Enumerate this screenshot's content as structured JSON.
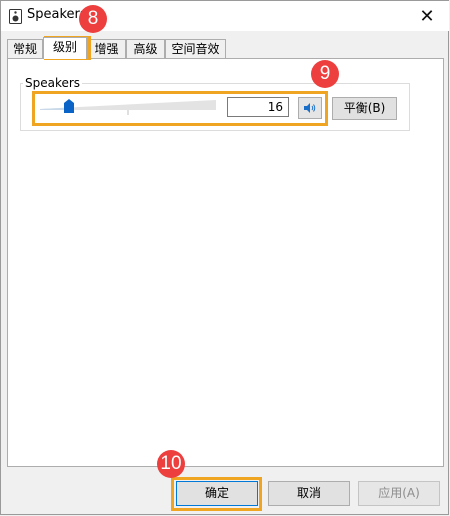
{
  "window": {
    "title": "Speakers",
    "close_icon": "close-icon",
    "app_icon": "speaker-device-icon"
  },
  "tabs": [
    {
      "label": "常规",
      "active": false
    },
    {
      "label": "级别",
      "active": true
    },
    {
      "label": "增强",
      "active": false
    },
    {
      "label": "高级",
      "active": false
    },
    {
      "label": "空间音效",
      "active": false
    }
  ],
  "levels": {
    "device_label": "Speakers",
    "volume_value": "16",
    "volume_fraction": 0.16,
    "mute_icon": "speaker-volume-icon",
    "balance_label": "平衡(B)"
  },
  "buttons": {
    "ok_label": "确定",
    "cancel_label": "取消",
    "apply_label": "应用(A)"
  },
  "annotations": {
    "badge_8": "8",
    "badge_9": "9",
    "badge_10": "10",
    "highlight_color": "#f0a522",
    "badge_color": "#ee3f3f"
  }
}
